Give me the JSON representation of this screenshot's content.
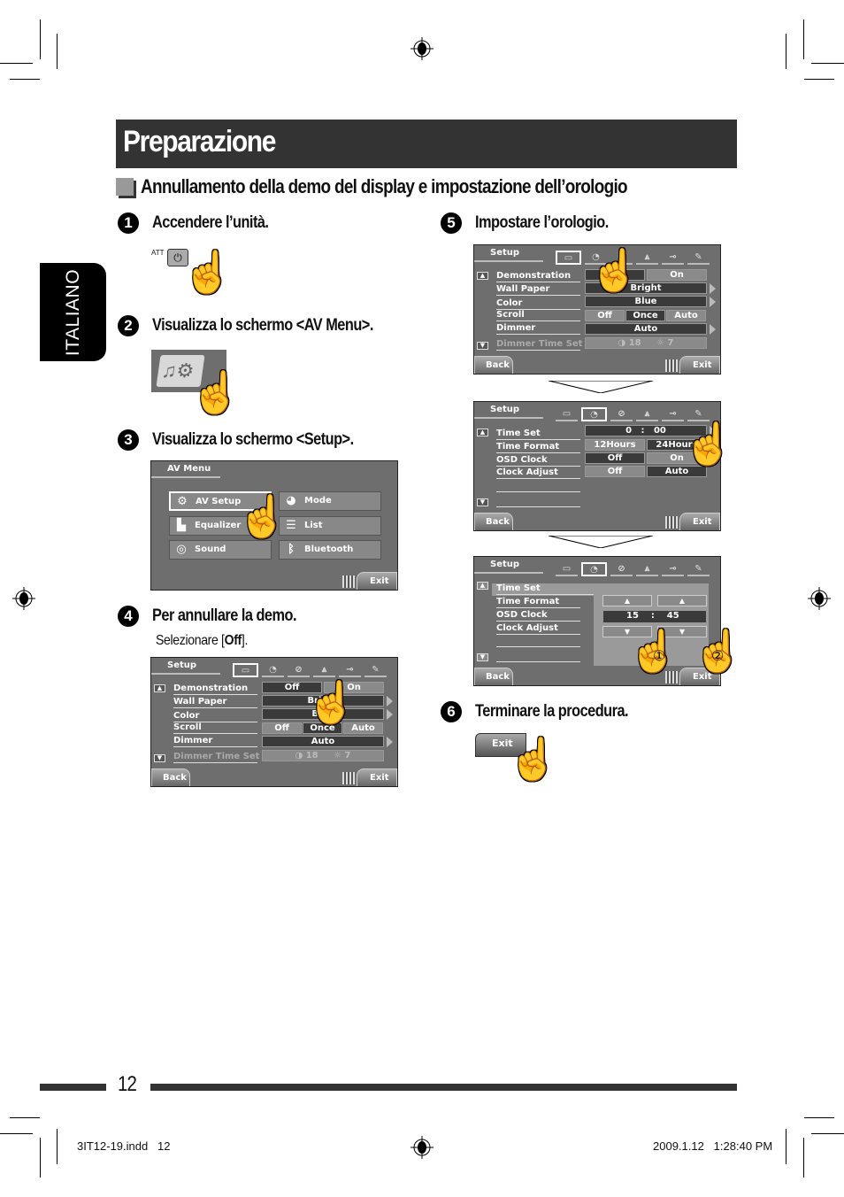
{
  "page": {
    "title": "Preparazione",
    "section_title": "Annullamento della demo del display e impostazione dell’orologio",
    "language_tab": "ITALIANO",
    "page_number": "12"
  },
  "steps": [
    {
      "number": "1",
      "text": "Accendere l’unità.",
      "button_label": "ATT",
      "button_icon": "power-icon"
    },
    {
      "number": "2",
      "text": "Visualizza lo schermo <AV Menu>."
    },
    {
      "number": "3",
      "text": "Visualizza lo schermo <Setup>."
    },
    {
      "number": "4",
      "text": "Per annullare la demo.",
      "sub_prefix": "Selezionare [",
      "sub_bold": "Off",
      "sub_suffix": "]."
    },
    {
      "number": "5",
      "text": "Impostare l’orologio."
    },
    {
      "number": "6",
      "text": "Terminare la procedura.",
      "button_label": "Exit"
    }
  ],
  "av_menu": {
    "title": "AV Menu",
    "items": [
      {
        "label": "AV Setup",
        "icon": "gear-icon",
        "selected": true
      },
      {
        "label": "Mode",
        "icon": "mode-icon"
      },
      {
        "label": "Equalizer",
        "icon": "equalizer-icon"
      },
      {
        "label": "List",
        "icon": "list-icon"
      },
      {
        "label": "Sound",
        "icon": "sound-icon"
      },
      {
        "label": "Bluetooth",
        "icon": "bluetooth-icon"
      }
    ],
    "exit_label": "Exit"
  },
  "setup_display": {
    "title": "Setup",
    "tabs": [
      "display-icon",
      "clock-icon",
      "disc-icon",
      "antenna-icon",
      "input-icon",
      "wrench-icon"
    ],
    "rows": [
      {
        "label": "Demonstration",
        "options": [
          "Off",
          "On"
        ],
        "selected": "Off"
      },
      {
        "label": "Wall Paper",
        "value": "Bright"
      },
      {
        "label": "Color",
        "value": "Blue"
      },
      {
        "label": "Scroll",
        "options": [
          "Off",
          "Once",
          "Auto"
        ],
        "selected": "Once"
      },
      {
        "label": "Dimmer",
        "value": "Auto"
      },
      {
        "label": "Dimmer Time Set",
        "off_time": "18",
        "on_time": "7"
      }
    ],
    "back_label": "Back",
    "exit_label": "Exit"
  },
  "setup_clock": {
    "title": "Setup",
    "rows": [
      {
        "label": "Time Set",
        "value": "0   :   00"
      },
      {
        "label": "Time Format",
        "options": [
          "12Hours",
          "24Hours"
        ],
        "selected": "24Hours"
      },
      {
        "label": "OSD Clock",
        "options": [
          "Off",
          "On"
        ],
        "selected": "Off"
      },
      {
        "label": "Clock Adjust",
        "options": [
          "Off",
          "Auto"
        ],
        "selected": "Auto"
      }
    ],
    "back_label": "Back",
    "exit_label": "Exit"
  },
  "setup_timeset": {
    "title": "Setup",
    "hours": "15",
    "separator": ":",
    "minutes": "45",
    "callouts": [
      "①",
      "②"
    ],
    "back_label": "Back",
    "exit_label": "Exit"
  },
  "footer": {
    "file": "3IT12-19.indd   12",
    "timestamp": "2009.1.12   1:28:40 PM"
  }
}
